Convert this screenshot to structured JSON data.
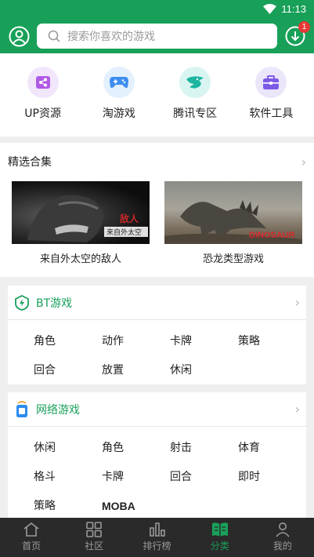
{
  "status_bar": {
    "time": "11:13"
  },
  "header": {
    "search_placeholder": "搜索你喜欢的游戏",
    "download_badge": "1"
  },
  "quick_entries": [
    {
      "label": "UP资源",
      "icon": "share-icon"
    },
    {
      "label": "淘游戏",
      "icon": "gamepad-icon"
    },
    {
      "label": "腾讯专区",
      "icon": "tencent-icon"
    },
    {
      "label": "软件工具",
      "icon": "toolbox-icon"
    }
  ],
  "collections": {
    "title": "精选合集",
    "items": [
      {
        "label": "来自外太空的敌人",
        "thumb_text": "敌人\n来自外太空"
      },
      {
        "label": "恐龙类型游戏",
        "thumb_text": "DINOSAUR"
      }
    ]
  },
  "bt_games": {
    "title": "BT游戏",
    "tags": [
      "角色",
      "动作",
      "卡牌",
      "策略",
      "回合",
      "放置",
      "休闲"
    ]
  },
  "online_games": {
    "title": "网络游戏",
    "tags": [
      "休闲",
      "角色",
      "射击",
      "体育",
      "格斗",
      "卡牌",
      "回合",
      "即时",
      "策略",
      "MOBA"
    ]
  },
  "bottom_nav": {
    "items": [
      {
        "label": "首页",
        "icon": "home-icon"
      },
      {
        "label": "社区",
        "icon": "community-icon"
      },
      {
        "label": "排行榜",
        "icon": "ranking-icon"
      },
      {
        "label": "分类",
        "icon": "category-icon"
      },
      {
        "label": "我的",
        "icon": "profile-icon"
      }
    ],
    "active": "分类"
  },
  "colors": {
    "brand_green": "#18a058",
    "badge_red": "#e53935",
    "nav_bg": "#2a2a2a"
  }
}
